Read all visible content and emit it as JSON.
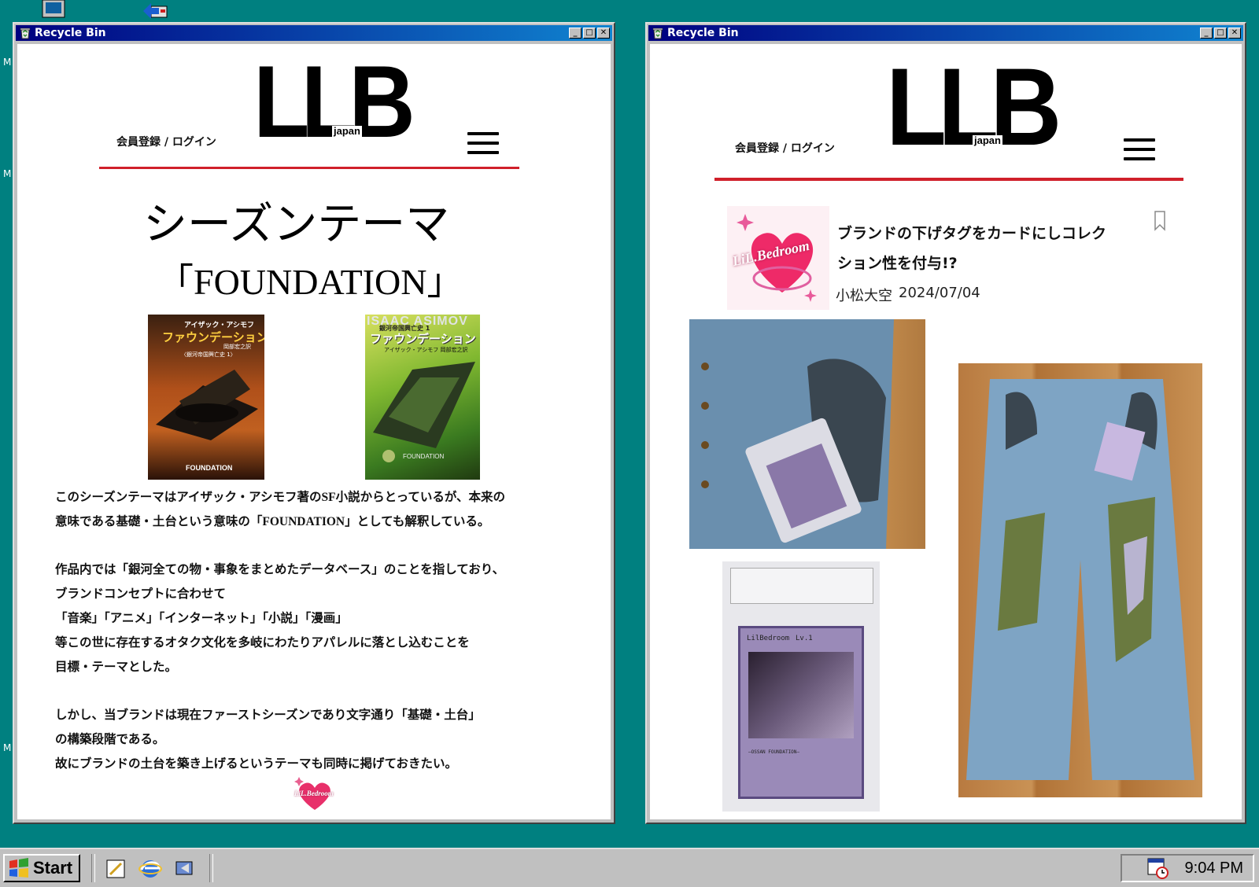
{
  "windows": [
    {
      "title": "Recycle Bin",
      "header": {
        "login": "会員登録 / ログイン",
        "logo": "LLB",
        "logo_sub": "japan"
      },
      "heading": "シーズンテーマ",
      "subheading": "「FOUNDATION」",
      "books": [
        {
          "author": "アイザック・アシモフ",
          "title": "ファウンデーション",
          "translator": "岡部宏之訳",
          "series": "〈銀河帝国興亡史 1〉",
          "bottom": "FOUNDATION"
        },
        {
          "top": "ISAAC ASIMOV",
          "series": "銀河帝国興亡史 1",
          "title": "ファウンデーション",
          "author": "アイザック・アシモフ 岡部宏之訳",
          "bottom": "FOUNDATION"
        }
      ],
      "paragraphs": [
        "このシーズンテーマはアイザック・アシモフ著のSF小説からとっているが、本来の",
        "意味である基礎・土台という意味の「FOUNDATION」としても解釈している。",
        "作品内では「銀河全ての物・事象をまとめたデータベース」のことを指しており、",
        "ブランドコンセプトに合わせて",
        "「音楽」「アニメ」「インターネット」「小説」「漫画」",
        "等この世に存在するオタク文化を多岐にわたりアパレルに落とし込むことを",
        "目標・テーマとした。",
        "しかし、当ブランドは現在ファーストシーズンであり文字通り「基礎・土台」",
        "の構築段階である。",
        "故にブランドの土台を築き上げるというテーマも同時に掲げておきたい。"
      ],
      "footer_logo": "LiL.Bedroom"
    },
    {
      "title": "Recycle Bin",
      "header": {
        "login": "会員登録 / ログイン",
        "logo": "LLB",
        "logo_sub": "japan"
      },
      "article": {
        "thumb_logo": "LiL.Bedroom",
        "title_line1": "ブランドの下げタグをカードにしコレク",
        "title_line2": "ション性を付与!?",
        "author": "小松大空",
        "date": "2024/07/04"
      },
      "card": {
        "name": "LilBedroom",
        "level": "Lv.1",
        "footer": "—OSSAN FOUNDATION—"
      }
    }
  ],
  "taskbar": {
    "start_label": "Start",
    "clock": "9:04 PM"
  },
  "colors": {
    "desktop": "#008080",
    "titlebar": "#000080",
    "accent_red": "#d0202a"
  }
}
